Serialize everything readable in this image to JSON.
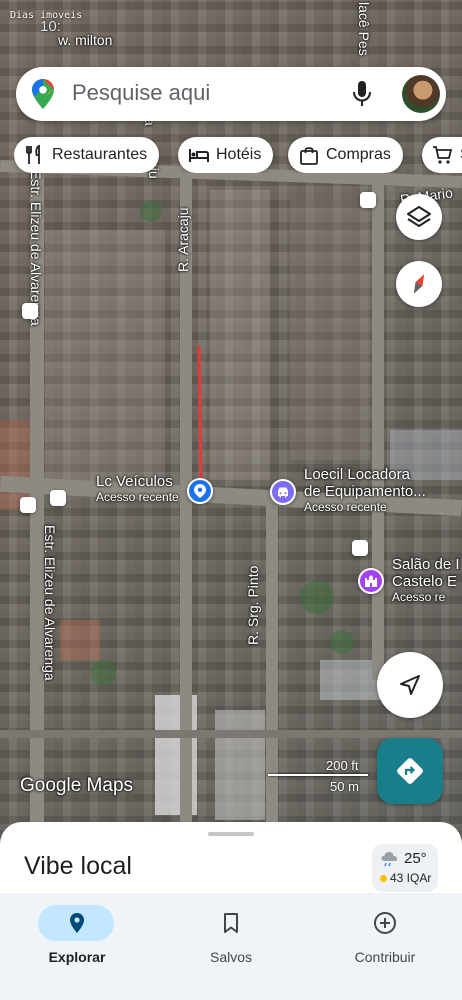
{
  "watermark": "Dias imoveis",
  "status_bar": {
    "time": "10:"
  },
  "search": {
    "placeholder": "Pesquise aqui"
  },
  "chips": [
    {
      "label": "Restaurantes",
      "icon": "fork-knife-icon"
    },
    {
      "label": "Hotéis",
      "icon": "bed-icon"
    },
    {
      "label": "Compras",
      "icon": "shopping-bag-icon"
    },
    {
      "label": "S",
      "icon": "cart-icon"
    }
  ],
  "map": {
    "street_labels": {
      "top_left": "w. milton",
      "top_right": "lacê Pes",
      "right_upper": "R. Mario",
      "aracaju": "R. Aracaju",
      "aracaju_top": "aju",
      "estrada_upper": "Estr. Elizeu de Alvarenga",
      "estrada_lower": "Estr. Elizeu de Alvarenga",
      "sargento_pinto": "R. Srg. Pinto",
      "left_edge": "a"
    },
    "pins": [
      {
        "name": "Lc Veículos",
        "subtitle": "Acesso recente",
        "icon": "location-pin-icon"
      },
      {
        "name": "Loecil Locadora",
        "name_line2": "de Equipamento...",
        "subtitle": "Acesso recente",
        "icon": "car-rental-icon"
      },
      {
        "name": "Salão de I",
        "name_line2": "Castelo E",
        "subtitle": "Acesso re",
        "icon": "castle-icon"
      }
    ],
    "scale": {
      "feet": "200 ft",
      "meters": "50 m"
    },
    "attribution": "Google Maps"
  },
  "sheet": {
    "title": "Vibe local",
    "weather": {
      "temperature": "25°",
      "air_quality": "43 IQAr"
    }
  },
  "nav": [
    {
      "label": "Explorar",
      "icon": "location-pin-icon",
      "active": true
    },
    {
      "label": "Salvos",
      "icon": "bookmark-icon",
      "active": false
    },
    {
      "label": "Contribuir",
      "icon": "add-circle-icon",
      "active": false
    }
  ],
  "colors": {
    "accent_blue": "#1a73e8",
    "directions_teal": "#1a7d8a",
    "route_red": "#e53935",
    "nav_pill": "#c2e7ff"
  }
}
